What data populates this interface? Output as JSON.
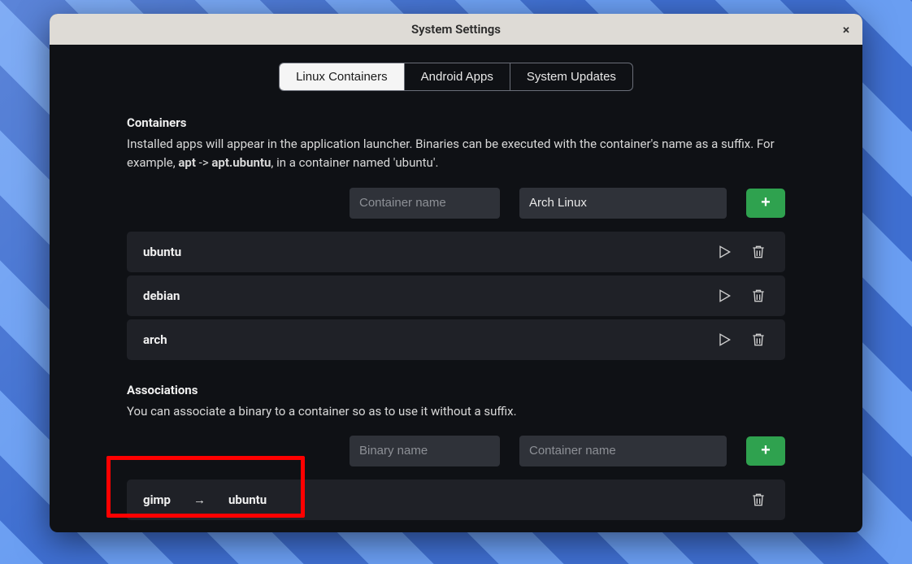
{
  "window": {
    "title": "System Settings",
    "close_label": "×"
  },
  "tabs": [
    {
      "id": "linux",
      "label": "Linux Containers",
      "active": true
    },
    {
      "id": "android",
      "label": "Android Apps",
      "active": false
    },
    {
      "id": "updates",
      "label": "System Updates",
      "active": false
    }
  ],
  "containers_section": {
    "heading": "Containers",
    "desc_pre": "Installed apps will appear in the application launcher. Binaries can be executed with the container's name as a suffix. For example, ",
    "desc_b1": "apt",
    "desc_mid": " -> ",
    "desc_b2": "apt.ubuntu",
    "desc_post": ", in a container named 'ubuntu'.",
    "name_placeholder": "Container name",
    "distro_value": "Arch Linux",
    "add_label": "+",
    "items": [
      {
        "name": "ubuntu"
      },
      {
        "name": "debian"
      },
      {
        "name": "arch"
      }
    ]
  },
  "associations_section": {
    "heading": "Associations",
    "desc": "You can associate a binary to a container so as to use it without a suffix.",
    "binary_placeholder": "Binary name",
    "container_placeholder": "Container name",
    "add_label": "+",
    "items": [
      {
        "binary": "gimp",
        "arrow": "→",
        "container": "ubuntu"
      }
    ]
  },
  "highlight": {
    "desc": "red annotation box around first association row"
  }
}
